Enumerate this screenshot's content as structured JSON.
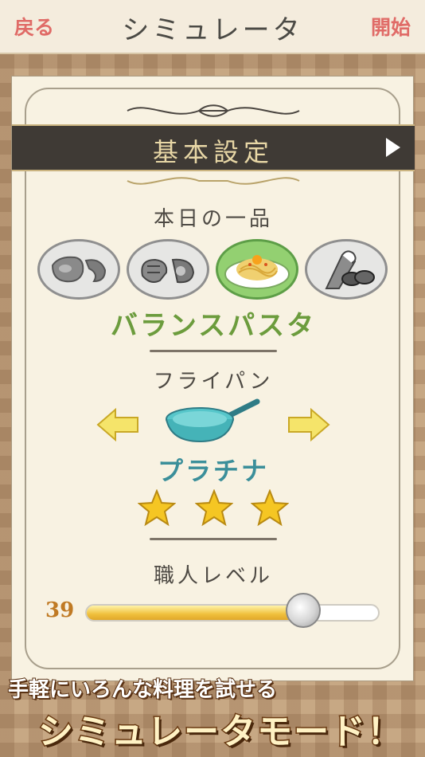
{
  "header": {
    "back_label": "戻る",
    "title": "シミュレータ",
    "start_label": "開始"
  },
  "basic_settings": {
    "section_title": "基本設定",
    "dish_heading": "本日の一品",
    "dishes": [
      {
        "icon": "meat-icon",
        "selected": false
      },
      {
        "icon": "fish-icon",
        "selected": false
      },
      {
        "icon": "pasta-icon",
        "selected": true
      },
      {
        "icon": "dessert-icon",
        "selected": false
      }
    ],
    "selected_dish_name": "バランスパスタ",
    "pan_heading": "フライパン",
    "pan_name": "プラチナ",
    "pan_stars": 3,
    "level_heading": "職人レベル",
    "level_value": "39",
    "level_fraction": 0.74
  },
  "promo": {
    "line1": "手軽にいろんな料理を試せる",
    "line2": "シミュレータモード！"
  },
  "colors": {
    "accent_red": "#e06b67",
    "dish_green": "#6c9c3d",
    "pan_teal": "#3b8f9a",
    "level_orange": "#c07a24"
  }
}
